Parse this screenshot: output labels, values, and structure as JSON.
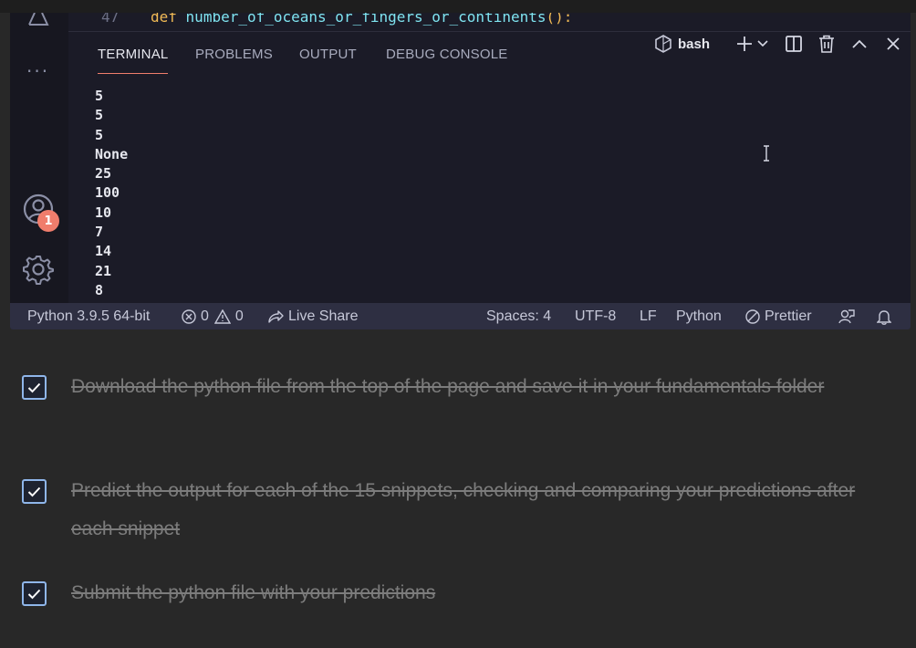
{
  "editor": {
    "line_number": "47",
    "keyword": "def",
    "function_name": "number_of_oceans_or_fingers_or_continents",
    "parens": "():"
  },
  "panel": {
    "tabs": [
      {
        "label": "TERMINAL",
        "active": true
      },
      {
        "label": "PROBLEMS",
        "active": false
      },
      {
        "label": "OUTPUT",
        "active": false
      },
      {
        "label": "DEBUG CONSOLE",
        "active": false
      }
    ],
    "shell_label": "bash",
    "actions": [
      "terminal-icon",
      "plus-icon",
      "chevron-down-icon",
      "split-icon",
      "trash-icon",
      "chevron-up-icon",
      "close-icon"
    ]
  },
  "terminal_output": [
    "5",
    "5",
    "5",
    "None",
    "25",
    "100",
    "10",
    "7",
    "14",
    "21",
    "8"
  ],
  "activity_bar": {
    "account_badge": "1",
    "accent": "#f07d6c"
  },
  "statusbar": {
    "interpreter": "Python 3.9.5 64-bit",
    "errors": "0",
    "warnings": "0",
    "live_share": "Live Share",
    "spaces": "Spaces: 4",
    "encoding": "UTF-8",
    "eol": "LF",
    "language": "Python",
    "formatter": "Prettier"
  },
  "checklist": [
    {
      "text": "Download the python file from the top of the page and save it in your fundamentals folder",
      "checked": true
    },
    {
      "text": "Predict the output for each of the 15 snippets, checking and comparing your predictions after each snippet",
      "checked": true
    },
    {
      "text": "Submit the python file with your predictions",
      "checked": true
    }
  ]
}
